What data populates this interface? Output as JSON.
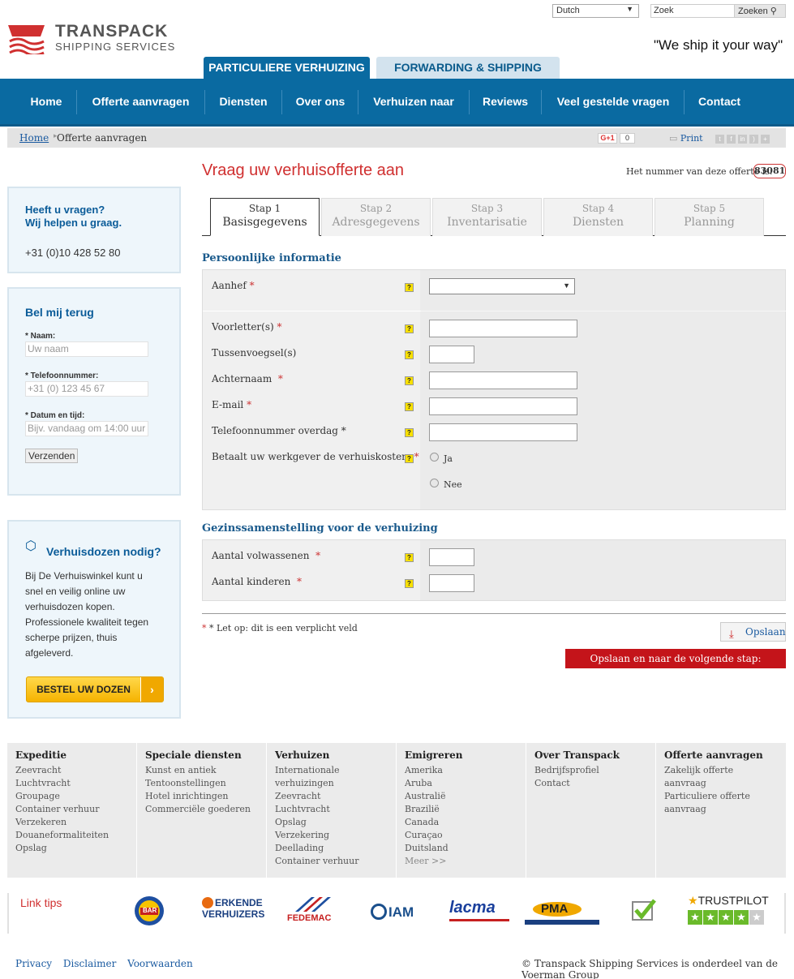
{
  "top": {
    "language": "Dutch",
    "search_value": "Zoek",
    "search_button": "Zoeken"
  },
  "brand": {
    "name": "TRANSPACK",
    "sub": "SHIPPING SERVICES",
    "slogan": "\"We ship it your way\""
  },
  "site_tabs": [
    "PARTICULIERE VERHUIZING",
    "FORWARDING & SHIPPING"
  ],
  "nav": [
    "Home",
    "Offerte aanvragen",
    "Diensten",
    "Over ons",
    "Verhuizen naar",
    "Reviews",
    "Veel gestelde vragen",
    "Contact"
  ],
  "breadcrumb": [
    "Home",
    "Offerte aanvragen"
  ],
  "share": {
    "gplus": "G+1",
    "count": "0",
    "print": "Print"
  },
  "sidebar": {
    "help": {
      "title1": "Heeft u vragen?",
      "title2": "Wij helpen u graag.",
      "phone": "+31 (0)10 428 52 80"
    },
    "callback": {
      "title": "Bel mij terug",
      "name_label": "* Naam:",
      "name_ph": "Uw naam",
      "phone_label": "* Telefoonnummer:",
      "phone_ph": "+31 (0) 123 45 67",
      "date_label": "* Datum en tijd:",
      "date_ph": "Bijv. vandaag om 14:00 uur",
      "submit": "Verzenden"
    },
    "boxes": {
      "title": "Verhuisdozen nodig?",
      "text": "Bij De Verhuiswinkel kunt u snel en veilig online uw verhuisdozen kopen. Professionele kwaliteit tegen scherpe prijzen, thuis afgeleverd.",
      "button": "BESTEL UW DOZEN"
    }
  },
  "main": {
    "title": "Vraag uw verhuisofferte aan",
    "number_label": "Het nummer van deze offerte is:",
    "number": "83081",
    "steps": [
      {
        "n": "Stap 1",
        "l": "Basisgegevens"
      },
      {
        "n": "Stap 2",
        "l": "Adresgegevens"
      },
      {
        "n": "Stap 3",
        "l": "Inventarisatie"
      },
      {
        "n": "Stap 4",
        "l": "Diensten"
      },
      {
        "n": "Stap 5",
        "l": "Planning"
      }
    ],
    "section1": "Persoonlijke informatie",
    "fields1": {
      "aanhef": "Aanhef",
      "voorletters": "Voorletter(s)",
      "tussenvoegsel": "Tussenvoegsel(s)",
      "achternaam": "Achternaam",
      "email": "E-mail",
      "telefoon": "Telefoonnummer overdag",
      "werkgever": "Betaalt uw werkgever de verhuiskosten",
      "ja": "Ja",
      "nee": "Nee"
    },
    "section2": "Gezinssamenstelling voor de verhuizing",
    "fields2": {
      "volwassenen": "Aantal volwassenen",
      "kinderen": "Aantal kinderen"
    },
    "required_note": "* Let op: dit is een verplicht veld",
    "save": "Opslaan",
    "next": "Opslaan en naar de volgende stap: Adresgegevens"
  },
  "footer": {
    "cols": [
      {
        "title": "Expeditie",
        "items": [
          "Zeevracht",
          "Luchtvracht",
          "Groupage",
          "Container verhuur",
          "Verzekeren",
          "Douaneformaliteiten",
          "Opslag"
        ]
      },
      {
        "title": "Speciale diensten",
        "items": [
          "Kunst en antiek",
          "Tentoonstellingen",
          "Hotel inrichtingen",
          "Commerciële goederen"
        ]
      },
      {
        "title": "Verhuizen",
        "items": [
          "Internationale verhuizingen",
          "Zeevracht",
          "Luchtvracht",
          "Opslag",
          "Verzekering",
          "Deellading",
          "Container verhuur"
        ]
      },
      {
        "title": "Emigreren",
        "items": [
          "Amerika",
          "Aruba",
          "Australië",
          "Brazilië",
          "Canada",
          "Curaçao",
          "Duitsland",
          "Meer >>"
        ]
      },
      {
        "title": "Over Transpack",
        "items": [
          "Bedrijfsprofiel",
          "Contact"
        ]
      },
      {
        "title": "Offerte aanvragen",
        "items": [
          "Zakelijk offerte aanvraag",
          "Particuliere offerte aanvraag"
        ]
      }
    ],
    "link_tips": "Link tips",
    "partners": [
      "BAR",
      "ERKENDE VERHUIZERS",
      "FEDEMAC",
      "IAM",
      "lacma",
      "PMA",
      "TRUSTPILOT"
    ],
    "bottom": [
      "Privacy",
      "Disclaimer",
      "Voorwaarden"
    ],
    "copyright": "© Transpack Shipping Services is onderdeel van de Voerman Group"
  }
}
